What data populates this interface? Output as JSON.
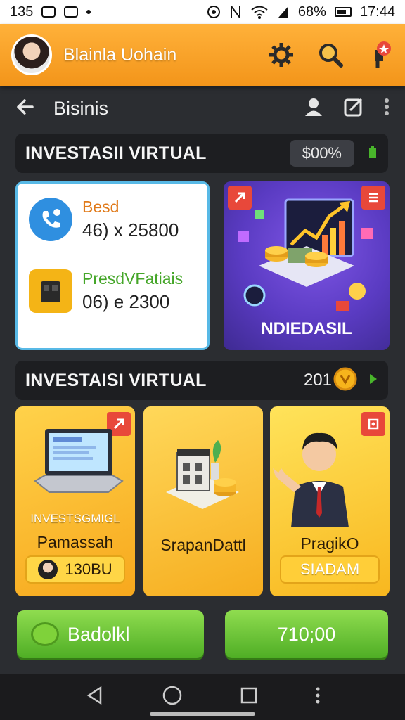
{
  "status_bar": {
    "time_left": "135",
    "battery": "68%",
    "clock": "17:44"
  },
  "header": {
    "user_name": "Blainla Uohain",
    "icons": [
      "settings-gear-icon",
      "search-icon",
      "notification-icon"
    ],
    "notification_dot_color": "#e8483a"
  },
  "nav": {
    "title": "Bisinis"
  },
  "section1": {
    "title": "INVESTASII VIRTUAL",
    "badge": "$00%"
  },
  "info_card": {
    "row1_label": "Besd",
    "row1_value": "46) x 25800",
    "row2_label": "PresdVFatiais",
    "row2_value": "06) e 2300"
  },
  "promo_card": {
    "label": "NDIEDASIL"
  },
  "section2": {
    "title": "INVESTAISI VIRTUAL",
    "count": "201"
  },
  "products": [
    {
      "subtitle": "INVESTSGMIGL",
      "name": "Pamassah",
      "chip": "130BU"
    },
    {
      "subtitle": "",
      "name": "SrapanDattl",
      "chip": ""
    },
    {
      "subtitle": "",
      "name": "PragikO",
      "chip": "SIADAM"
    }
  ],
  "buttons": {
    "left_label": "Badolkl",
    "right_label": "710;00"
  },
  "colors": {
    "header_orange": "#f3951a",
    "green_button": "#4fae25",
    "panel_dark": "#1d1e21"
  }
}
